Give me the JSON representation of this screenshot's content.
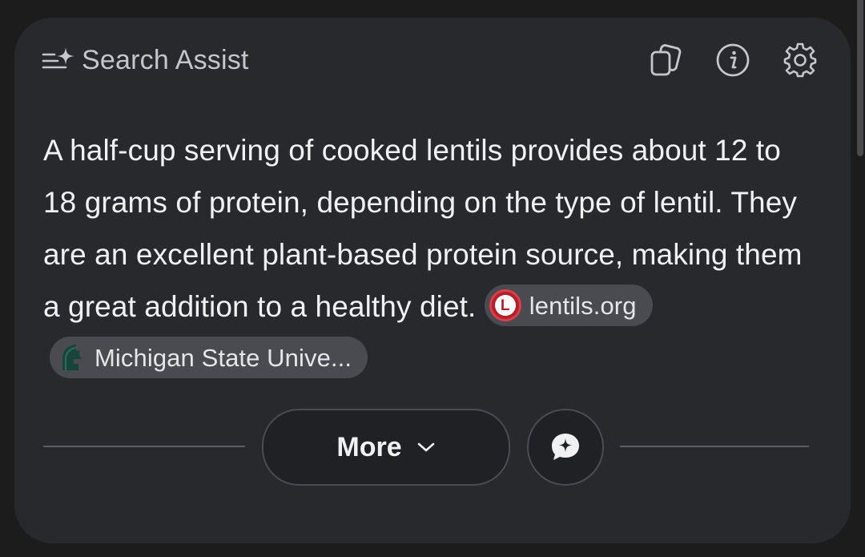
{
  "header": {
    "title": "Search Assist",
    "icon": "sparkle-list-icon",
    "actions": [
      {
        "name": "copy-pages-icon"
      },
      {
        "name": "info-icon"
      },
      {
        "name": "settings-icon"
      }
    ]
  },
  "answer": {
    "text": "A half-cup serving of cooked lentils provides about 12 to 18 grams of protein, depending on the type of lentil. They are an excellent plant-based protein source, making them a great addition to a healthy diet.",
    "sources": [
      {
        "label": "lentils.org",
        "icon": "lentils-logo-icon",
        "icon_letter": "L",
        "color": "#b21f2d"
      },
      {
        "label": "Michigan State Unive...",
        "icon": "spartan-helmet-icon",
        "color": "#18453b"
      }
    ]
  },
  "footer": {
    "more_label": "More",
    "more_icon": "chevron-down-icon",
    "chat_icon": "chat-sparkle-icon"
  },
  "colors": {
    "background": "#1c1c1c",
    "card": "#28292d",
    "chip": "#4a4b50",
    "text": "#f1f1f3"
  }
}
